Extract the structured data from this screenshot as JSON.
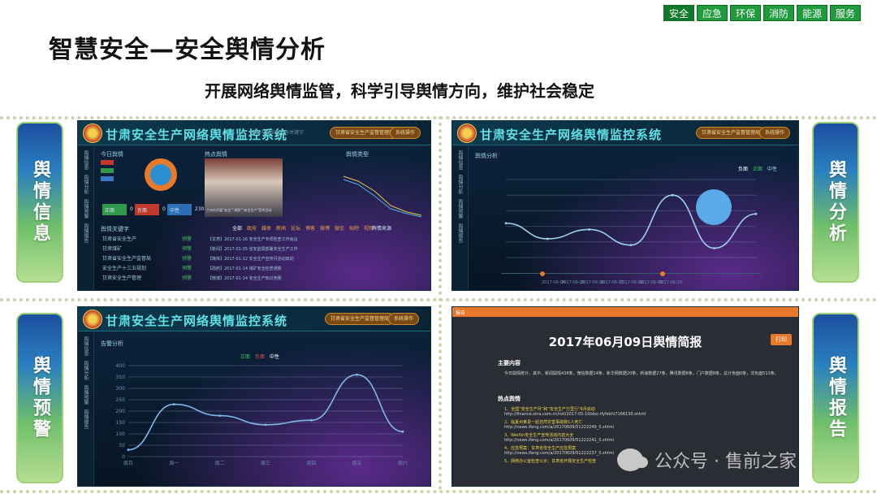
{
  "top_nav": {
    "tabs": [
      "安全",
      "应急",
      "环保",
      "消防",
      "能源",
      "服务"
    ],
    "active": "安全"
  },
  "page_title": "智慧安全—安全舆情分析",
  "subtitle": "开展网络舆情监管，科学引导舆情方向，维护社会稳定",
  "pills": [
    {
      "label": "舆情信息"
    },
    {
      "label": "舆情分析"
    },
    {
      "label": "舆情预警"
    },
    {
      "label": "舆情报告"
    }
  ],
  "system_title": "甘肃安全生产网络舆情监控系统",
  "header_buttons": [
    "甘肃省安全生产监督管理局",
    "系统操作"
  ],
  "panel_info": {
    "search_placeholder": "请输入搜索的内容关键字",
    "sidebar": [
      "舆情信息",
      "舆情分析",
      "舆情预警",
      "舆情报告"
    ],
    "today_label": "今日舆情",
    "hot_label": "热点舆情",
    "type_label": "舆情类型",
    "keyword_label": "舆情关键字",
    "counts": [
      {
        "label": "正面",
        "value": "0"
      },
      {
        "label": "负面",
        "value": "0"
      },
      {
        "label": "中性",
        "value": "230"
      }
    ],
    "keywords": [
      "甘肃省安全生产",
      "甘肃煤矿",
      "甘肃省安全生产监督局",
      "安全生产十三五规划",
      "甘肃安全生产管理"
    ],
    "keyword_tags": [
      "预警",
      "预警",
      "预警",
      "预警",
      "预警"
    ],
    "news_tabs": [
      "全部",
      "政府",
      "媒体",
      "新闻",
      "论坛",
      "博客",
      "微博",
      "微信",
      "贴吧",
      "视频"
    ],
    "news_header": "舆情来源",
    "news_items": [
      "【甘肃】2017-01-16 安全生产专项检查工作会议",
      "【新闻】2017-01-05 省安监局部署安全生产工作",
      "【媒体】2017-01-12 安全生产宣传月活动启动",
      "【政府】2017-01-14 煤矿安全检查通报",
      "【微博】2017-01-14 安全生产知识竞赛"
    ],
    "photo_caption": "兰州市开展“安全”“消防”“安全生产”宣传活动"
  },
  "panel_analysis": {
    "title": "舆情分析",
    "legend": [
      "负面",
      "正面",
      "中性"
    ],
    "dates": [
      "2017-06-04",
      "2017-06-05",
      "2017-06-06",
      "2017-06-07",
      "2017-06-08",
      "2017-06-09",
      "2017-06-10"
    ],
    "side_tabs": [
      "舆情信息",
      "舆情分析",
      "舆情预警",
      "舆情报告"
    ]
  },
  "panel_warning": {
    "title": "告警分析",
    "legend": [
      "正面",
      "负面",
      "中性"
    ],
    "y_ticks": [
      "400",
      "350",
      "300",
      "250",
      "200",
      "150",
      "100",
      "50",
      "0"
    ],
    "x_ticks": [
      "周日",
      "周一",
      "周二",
      "周三",
      "周四",
      "周五",
      "周六"
    ],
    "side_tabs": [
      "舆情信息",
      "舆情分析",
      "舆情预警",
      "舆情报告"
    ]
  },
  "panel_report": {
    "window_label": "报告",
    "title": "2017年06月09日舆情简报",
    "print_label": "打印",
    "section_main": "主要内容",
    "main_text": "今日舆情统计，其中，新闻舆情438条，微信数据14条，新华网数据20条，新浪数据27条，腾讯数据8条，门户数据8条，总计负面0条，非负面513条。",
    "section_hot": "热点舆情",
    "hot_items": [
      {
        "title": "1、全国“安全生产月”和“安全生产万里行”6月启动",
        "url": "http://finance.sina.com.cn/roll/2017-05-10/doc-ifyfekhi7166130.shtml"
      },
      {
        "title": "2、临夏州某县一起自然灾害事故致1人死亡",
        "url": "http://news.ifeng.com/a/20170609/51222249_0.shtml"
      },
      {
        "title": "3、WeiXin安全生产宣传活动内容大全",
        "url": "http://news.ifeng.com/a/20170609/51222241_0.shtml"
      },
      {
        "title": "4、应急预案：甘肃省安全生产应急预案",
        "url": "http://news.ifeng.com/a/20170609/51222237_0.shtml"
      },
      {
        "title": "5、网络办公室检查公示：甘肃省开展安全生产检查",
        "url": ""
      }
    ]
  },
  "watermark": "公众号 · 售前之家",
  "colors": {
    "nav_green": "#1f9a3c",
    "pill_top": "#1c4fa0",
    "pill_bottom": "#b6df92",
    "sys_title": "#5fe0e6",
    "accent_orange": "#e8792a"
  },
  "chart_data": [
    {
      "type": "line",
      "title": "舆情分析",
      "categories": [
        "2017-06-04",
        "2017-06-05",
        "2017-06-06",
        "2017-06-07",
        "2017-06-08",
        "2017-06-09",
        "2017-06-10"
      ],
      "series": [
        {
          "name": "中性",
          "values": [
            110,
            60,
            90,
            40,
            200,
            30,
            140
          ]
        }
      ],
      "ylim": [
        0,
        250
      ],
      "grid": true,
      "legend": "top-right"
    },
    {
      "type": "line",
      "title": "告警分析",
      "categories": [
        "周日",
        "周一",
        "周二",
        "周三",
        "周四",
        "周五",
        "周六"
      ],
      "series": [
        {
          "name": "中性",
          "values": [
            30,
            230,
            180,
            140,
            160,
            360,
            110
          ]
        }
      ],
      "ylim": [
        0,
        400
      ],
      "grid": true,
      "legend": "top-center"
    }
  ]
}
